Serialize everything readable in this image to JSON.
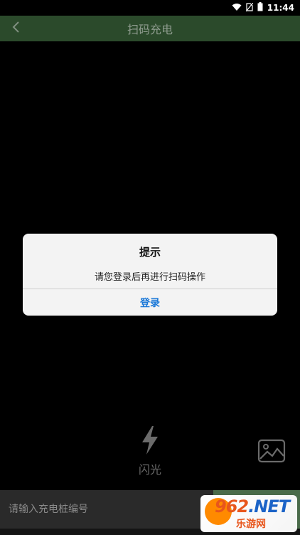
{
  "status_bar": {
    "time": "11:44",
    "icons": [
      "wifi-icon",
      "no-sim-icon",
      "battery-icon"
    ]
  },
  "nav": {
    "title": "扫码充电",
    "back_icon": "chevron-left-icon"
  },
  "dialog": {
    "title": "提示",
    "message": "请您登录后再进行扫码操作",
    "button_label": "登录",
    "button_color": "#1a78d8"
  },
  "controls": {
    "flash_label": "闪光",
    "flash_icon": "lightning-icon",
    "album_icon": "image-icon"
  },
  "bottom": {
    "input_placeholder": "请输入充电桩编号",
    "input_value": ""
  },
  "watermark": {
    "brand": "962",
    "domain": ".NET",
    "tagline": "乐游网"
  },
  "colors": {
    "nav_background": "#2b4a2b",
    "accent": "#1a78d8"
  }
}
